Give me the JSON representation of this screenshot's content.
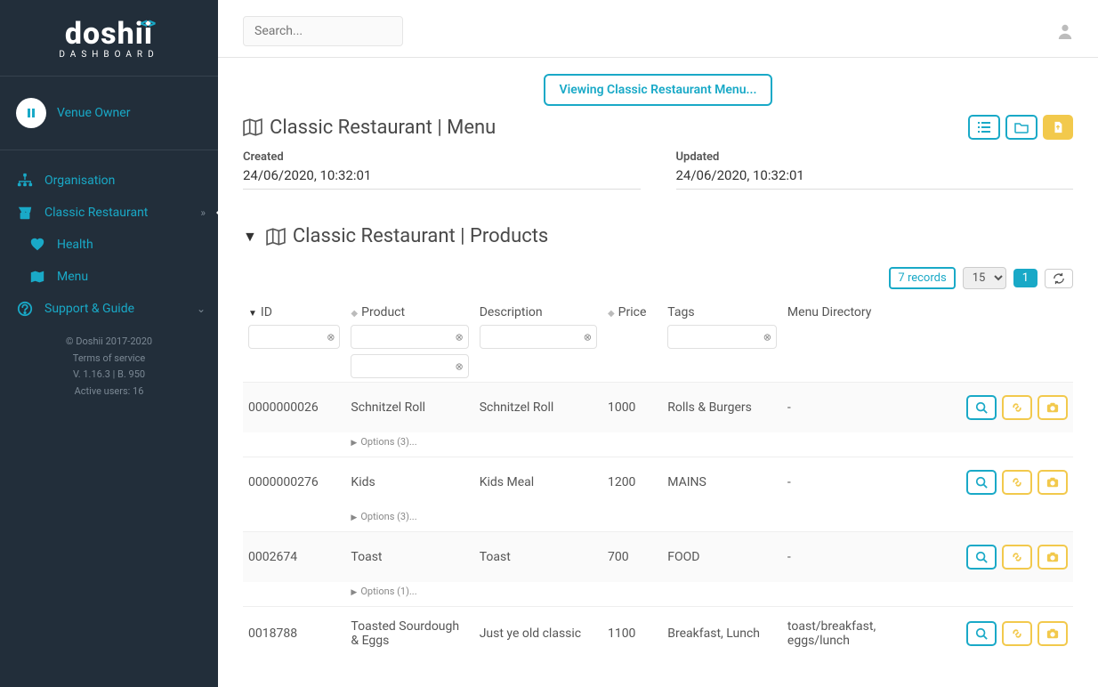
{
  "brand": {
    "name": "doshii",
    "subtitle": "DASHBOARD"
  },
  "sidebar": {
    "venue_owner": "Venue Owner",
    "organisation": "Organisation",
    "restaurant": "Classic Restaurant",
    "health": "Health",
    "menu": "Menu",
    "support": "Support & Guide",
    "footer_copyright": "© Doshii 2017-2020",
    "footer_terms": "Terms of service",
    "footer_version": "V. 1.16.3 | B. 950",
    "footer_active": "Active users: 16"
  },
  "topbar": {
    "search_placeholder": "Search..."
  },
  "notice": "Viewing Classic Restaurant Menu...",
  "menu_section": {
    "title": "Classic Restaurant | Menu",
    "created_label": "Created",
    "created_value": "24/06/2020, 10:32:01",
    "updated_label": "Updated",
    "updated_value": "24/06/2020, 10:32:01"
  },
  "products_section": {
    "title": "Classic Restaurant | Products",
    "records": "7 records",
    "page_size": "15",
    "page_num": "1"
  },
  "columns": {
    "id": "ID",
    "product": "Product",
    "description": "Description",
    "price": "Price",
    "tags": "Tags",
    "menu_dir": "Menu Directory"
  },
  "rows": [
    {
      "id": "0000000026",
      "product": "Schnitzel Roll",
      "description": "Schnitzel Roll",
      "price": "1000",
      "tags": "Rolls & Burgers",
      "menu_dir": "-",
      "options": "Options (3)..."
    },
    {
      "id": "0000000276",
      "product": "Kids",
      "description": "Kids Meal",
      "price": "1200",
      "tags": "MAINS",
      "menu_dir": "-",
      "options": "Options (3)..."
    },
    {
      "id": "0002674",
      "product": "Toast",
      "description": "Toast",
      "price": "700",
      "tags": "FOOD",
      "menu_dir": "-",
      "options": "Options (1)..."
    },
    {
      "id": "0018788",
      "product": "Toasted Sourdough & Eggs",
      "description": "Just ye old classic",
      "price": "1100",
      "tags": "Breakfast, Lunch",
      "menu_dir": "toast/breakfast, eggs/lunch",
      "options": ""
    }
  ]
}
